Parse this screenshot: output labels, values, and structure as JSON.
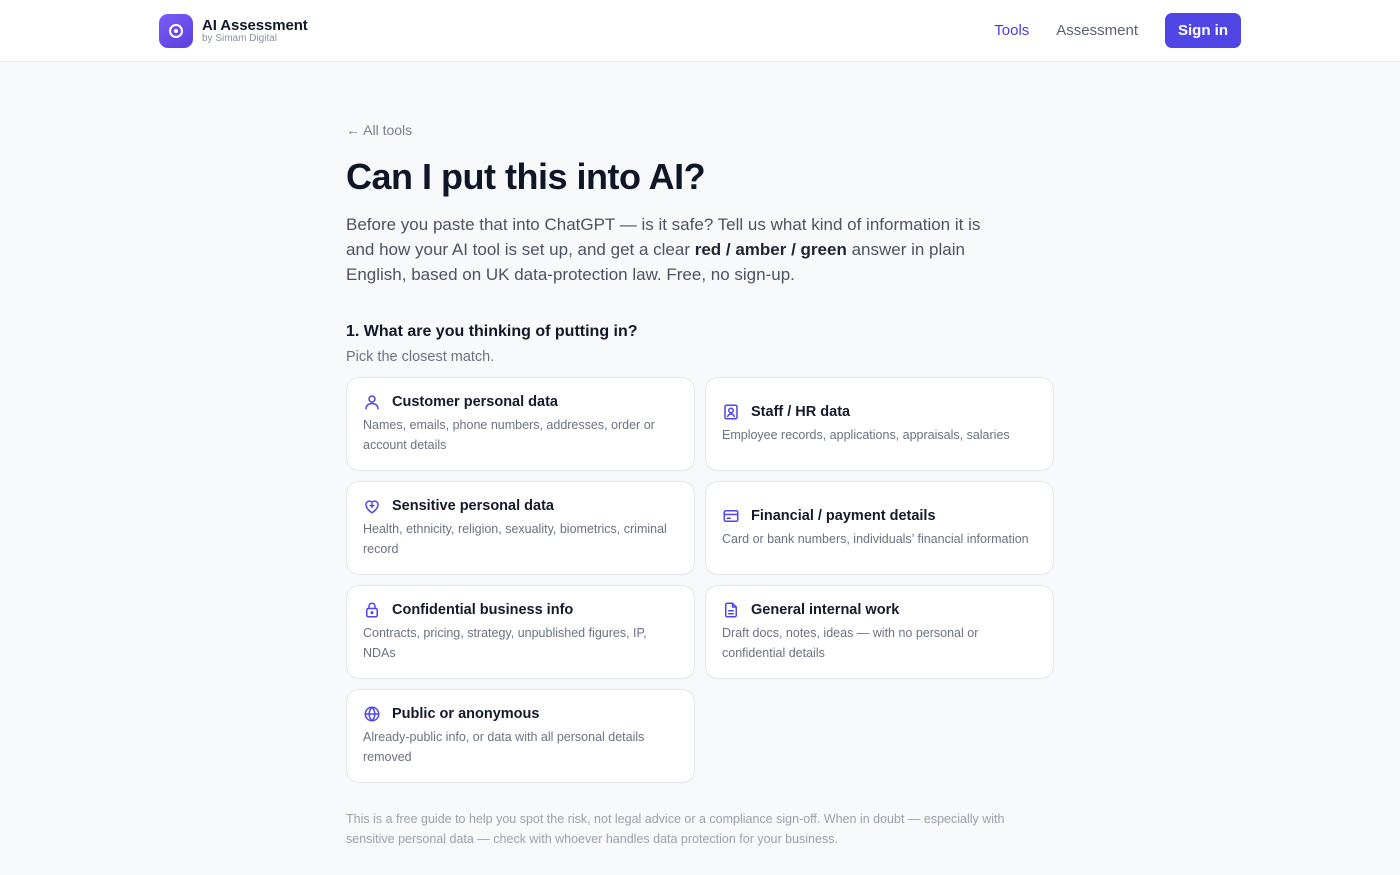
{
  "brand": {
    "title": "AI Assessment",
    "subtitle": "by Simam Digital"
  },
  "nav": {
    "tools": "Tools",
    "assessment": "Assessment",
    "signin": "Sign in"
  },
  "back_link": "← All tools",
  "heading": "Can I put this into AI?",
  "intro": {
    "part1": "Before you paste that into ChatGPT — is it safe? Tell us what kind of information it is and how your AI tool is set up, and get a clear ",
    "bold": "red / amber / green",
    "part2": " answer in plain English, based on UK data-protection law. Free, no sign-up."
  },
  "question": {
    "title": "1. What are you thinking of putting in?",
    "hint": "Pick the closest match."
  },
  "options": [
    {
      "icon": "person-icon",
      "title": "Customer personal data",
      "desc": "Names, emails, phone numbers, addresses, order or account details"
    },
    {
      "icon": "id-badge-icon",
      "title": "Staff / HR data",
      "desc": "Employee records, applications, appraisals, salaries"
    },
    {
      "icon": "heart-shield-icon",
      "title": "Sensitive personal data",
      "desc": "Health, ethnicity, religion, sexuality, biometrics, criminal record"
    },
    {
      "icon": "credit-card-icon",
      "title": "Financial / payment details",
      "desc": "Card or bank numbers, individuals’ financial information"
    },
    {
      "icon": "lock-icon",
      "title": "Confidential business info",
      "desc": "Contracts, pricing, strategy, unpublished figures, IP, NDAs"
    },
    {
      "icon": "document-icon",
      "title": "General internal work",
      "desc": "Draft docs, notes, ideas — with no personal or confidential details"
    },
    {
      "icon": "globe-icon",
      "title": "Public or anonymous",
      "desc": "Already-public info, or data with all personal details removed"
    }
  ],
  "disclaimer": "This is a free guide to help you spot the risk, not legal advice or a compliance sign-off. When in doubt — especially with sensitive personal data — check with whoever handles data protection for your business.",
  "colors": {
    "accent": "#4f46e5",
    "background": "#f8f9fb"
  }
}
